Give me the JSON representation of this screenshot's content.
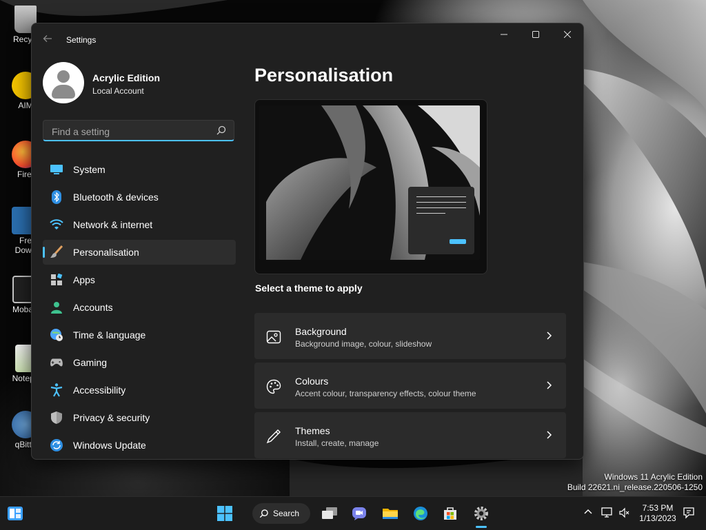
{
  "desktop": {
    "icons": [
      {
        "label": "Recycl"
      },
      {
        "label": "AIM"
      },
      {
        "label": "Firef"
      },
      {
        "label": "Fre\nDown"
      },
      {
        "label": "MobaX"
      },
      {
        "label": "Notepa"
      },
      {
        "label": "qBitto"
      }
    ],
    "watermark": {
      "line1": "Windows 11 Acrylic Edition",
      "line2": "Build 22621.ni_release.220506-1250"
    }
  },
  "window": {
    "title": "Settings",
    "controls": {
      "minimize": "—",
      "maximize": "☐",
      "close": "✕"
    }
  },
  "user": {
    "name": "Acrylic Edition",
    "account_type": "Local Account"
  },
  "search": {
    "placeholder": "Find a setting"
  },
  "nav": {
    "items": [
      {
        "label": "System",
        "icon": "system-icon"
      },
      {
        "label": "Bluetooth & devices",
        "icon": "bluetooth-icon"
      },
      {
        "label": "Network & internet",
        "icon": "wifi-icon"
      },
      {
        "label": "Personalisation",
        "icon": "brush-icon",
        "active": true
      },
      {
        "label": "Apps",
        "icon": "apps-icon"
      },
      {
        "label": "Accounts",
        "icon": "accounts-icon"
      },
      {
        "label": "Time & language",
        "icon": "globe-clock-icon"
      },
      {
        "label": "Gaming",
        "icon": "gamepad-icon"
      },
      {
        "label": "Accessibility",
        "icon": "accessibility-icon"
      },
      {
        "label": "Privacy & security",
        "icon": "shield-icon"
      },
      {
        "label": "Windows Update",
        "icon": "update-icon"
      }
    ]
  },
  "main": {
    "title": "Personalisation",
    "theme_prompt": "Select a theme to apply",
    "cards": [
      {
        "title": "Background",
        "subtitle": "Background image, colour, slideshow",
        "icon": "image-icon"
      },
      {
        "title": "Colours",
        "subtitle": "Accent colour, transparency effects, colour theme",
        "icon": "palette-icon"
      },
      {
        "title": "Themes",
        "subtitle": "Install, create, manage",
        "icon": "pen-icon"
      }
    ]
  },
  "taskbar": {
    "search_label": "Search",
    "time": "7:53 PM",
    "date": "1/13/2023"
  },
  "colors": {
    "accent": "#4cc2ff",
    "window_bg": "#202020",
    "card_bg": "#2b2b2b"
  }
}
